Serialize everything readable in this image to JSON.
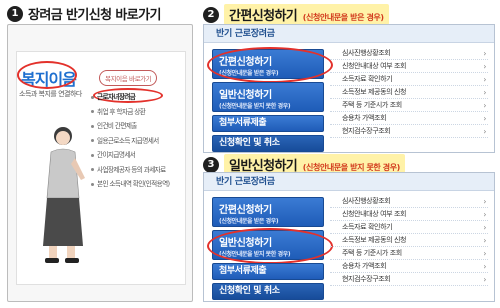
{
  "step1": {
    "number": "1",
    "title": "장려금 반기신청 바로가기"
  },
  "step2": {
    "number": "2",
    "title": "간편신청하기",
    "note": "(신청안내문을 받은 경우)"
  },
  "step3": {
    "number": "3",
    "title": "일반신청하기",
    "note": "(신청안내문을 받지 못한 경우)"
  },
  "panel1": {
    "brand": "복지이음",
    "brand_sub": "소득과 복지를 연결하다",
    "menu_button": "복지이음 바로가기",
    "menu_items": [
      "근로자녀장려금",
      "취업 후 학자금 상환",
      "인건비 간편제출",
      "일용근로소득 지급명세서",
      "간이지급명세서",
      "사업장제공자 등의 과세자료",
      "본인 소득내역 확인(인적용역)"
    ]
  },
  "panel2": {
    "header": "반기 근로장려금",
    "buttons": [
      {
        "main": "간편신청하기",
        "sub": "(신청안내문을 받은 경우)"
      },
      {
        "main": "일반신청하기",
        "sub": "(신청안내문을 받지 못한 경우)"
      },
      {
        "main": "첨부서류제출"
      },
      {
        "main": "신청확인 및 취소"
      }
    ],
    "links": [
      "심사진행상황조회",
      "신청안내대상 여부 조회",
      "소득자료 확인하기",
      "소득정보 제공동의 신청",
      "주택 등 기준시가 조회",
      "승용차 가액조회",
      "현지검수장구조회"
    ],
    "arrow": "›"
  },
  "panel3": {
    "header": "반기 근로장려금",
    "buttons": [
      {
        "main": "간편신청하기",
        "sub": "(신청안내문을 받은 경우)"
      },
      {
        "main": "일반신청하기",
        "sub": "(신청안내문을 받지 못한 경우)"
      },
      {
        "main": "첨부서류제출"
      },
      {
        "main": "신청확인 및 취소"
      }
    ],
    "links": [
      "심사진행상황조회",
      "신청안내대상 여부 조회",
      "소득자료 확인하기",
      "소득정보 제공동의 신청",
      "주택 등 기준시가 조회",
      "승용차 가액조회",
      "현지검수장구조회"
    ],
    "arrow": "›"
  },
  "colors": {
    "highlight_oval": "#e3312b",
    "button_blue": "#1f5cb8",
    "title_band": "#fff2a8",
    "note_red": "#d23a1d"
  }
}
